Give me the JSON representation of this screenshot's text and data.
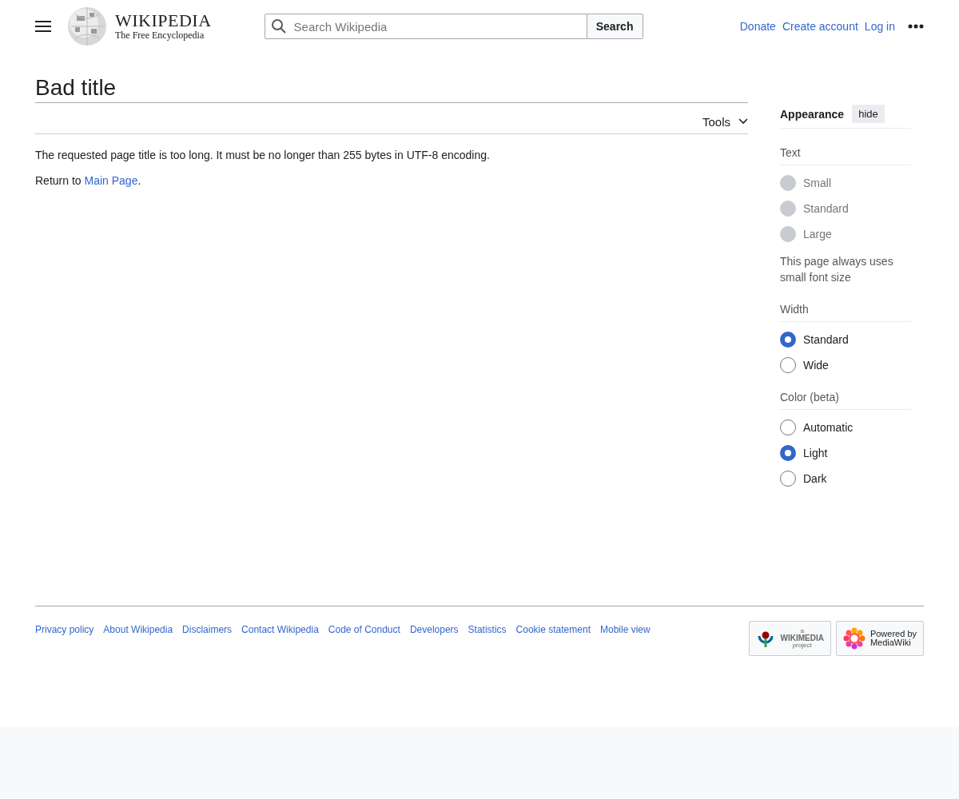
{
  "header": {
    "wordmark": "WIKIPEDIA",
    "tagline": "The Free Encyclopedia",
    "search": {
      "placeholder": "Search Wikipedia",
      "button": "Search"
    },
    "links": [
      "Donate",
      "Create account",
      "Log in"
    ]
  },
  "page": {
    "title": "Bad title",
    "tools": "Tools",
    "message": "The requested page title is too long. It must be no longer than 255 bytes in UTF-8 encoding.",
    "return_prefix": "Return to ",
    "return_link": "Main Page",
    "return_suffix": "."
  },
  "appearance": {
    "title": "Appearance",
    "hide": "hide",
    "sections": [
      {
        "heading": "Text",
        "options": [
          {
            "label": "Small",
            "selected": false,
            "disabled": true
          },
          {
            "label": "Standard",
            "selected": false,
            "disabled": true
          },
          {
            "label": "Large",
            "selected": false,
            "disabled": true
          }
        ],
        "note": "This page always uses small font size"
      },
      {
        "heading": "Width",
        "options": [
          {
            "label": "Standard",
            "selected": true,
            "disabled": false
          },
          {
            "label": "Wide",
            "selected": false,
            "disabled": false
          }
        ]
      },
      {
        "heading": "Color (beta)",
        "options": [
          {
            "label": "Automatic",
            "selected": false,
            "disabled": false
          },
          {
            "label": "Light",
            "selected": true,
            "disabled": false
          },
          {
            "label": "Dark",
            "selected": false,
            "disabled": false
          }
        ]
      }
    ]
  },
  "footer": {
    "links": [
      "Privacy policy",
      "About Wikipedia",
      "Disclaimers",
      "Contact Wikipedia",
      "Code of Conduct",
      "Developers",
      "Statistics",
      "Cookie statement",
      "Mobile view"
    ],
    "badges": [
      {
        "kind": "wikimedia",
        "lines": [
          "a",
          "WIKIMEDIA",
          "project"
        ]
      },
      {
        "kind": "mediawiki",
        "lines": [
          "Powered by",
          "MediaWiki"
        ]
      }
    ]
  }
}
